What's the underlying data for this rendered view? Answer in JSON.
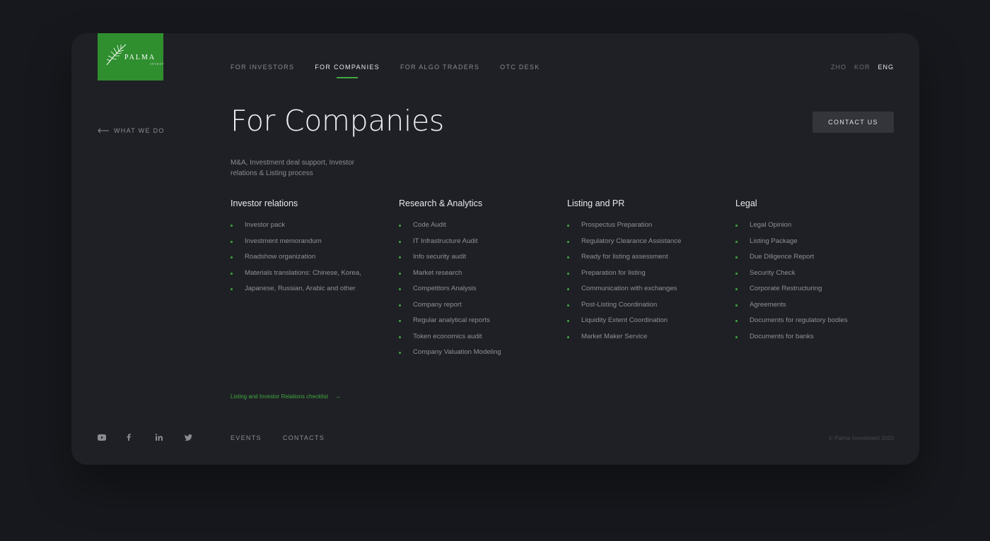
{
  "brand": {
    "name": "PALMA",
    "sub": "INVEST"
  },
  "nav": [
    {
      "label": "FOR INVESTORS",
      "active": false
    },
    {
      "label": "FOR COMPANIES",
      "active": true
    },
    {
      "label": "FOR ALGO TRADERS",
      "active": false
    },
    {
      "label": "OTC DESK",
      "active": false
    }
  ],
  "langs": [
    {
      "label": "ZHO",
      "active": false
    },
    {
      "label": "KOR",
      "active": false
    },
    {
      "label": "ENG",
      "active": true
    }
  ],
  "back": {
    "label": "WHAT WE DO"
  },
  "page": {
    "title": "For Companies",
    "subtitle": "M&A, Investment deal support, Investor relations & Listing process",
    "contact_label": "CONTACT US"
  },
  "columns": [
    {
      "title": "Investor relations",
      "items": [
        "Investor pack",
        "Investment memorandum",
        "Roadshow organization",
        "Materials translations: Chinese, Korea,",
        "Japanese, Russian, Arabic and other"
      ]
    },
    {
      "title": "Research & Analytics",
      "items": [
        "Code Audit",
        "IT Infrastructure Audit",
        "Info security audit",
        "Market research",
        "Competitors Analysis",
        "Company report",
        "Regular analytical reports",
        "Token economics audit",
        "Company Valuation Modeling"
      ]
    },
    {
      "title": "Listing and PR",
      "items": [
        "Prospectus Preparation",
        "Regulatory Clearance Assistance",
        "Ready for listing assessment",
        "Preparation for listing",
        "Communication with exchanges",
        "Post-Listing Coordination",
        "Liquidity Extent Coordination",
        "Market Maker Service"
      ]
    },
    {
      "title": "Legal",
      "items": [
        "Legal Opinion",
        "Listing Package",
        "Due Diligence Report",
        "Security Check",
        "Corporate Restructuring",
        "Agreements",
        "Documents for regulatory bodies",
        "Documents for banks"
      ]
    }
  ],
  "checklist": {
    "label": "Listing and Investor Relations checklist",
    "arrow": "→"
  },
  "socials": [
    "youtube-icon",
    "facebook-icon",
    "linkedin-icon",
    "twitter-icon"
  ],
  "footer": {
    "links": [
      "EVENTS",
      "CONTACTS"
    ],
    "copyright": "© Palma Investment 2020"
  },
  "colors": {
    "accent": "#3fa83f",
    "logo_bg": "#2f8f2f",
    "card": "#1f2025",
    "background": "#17181d"
  }
}
